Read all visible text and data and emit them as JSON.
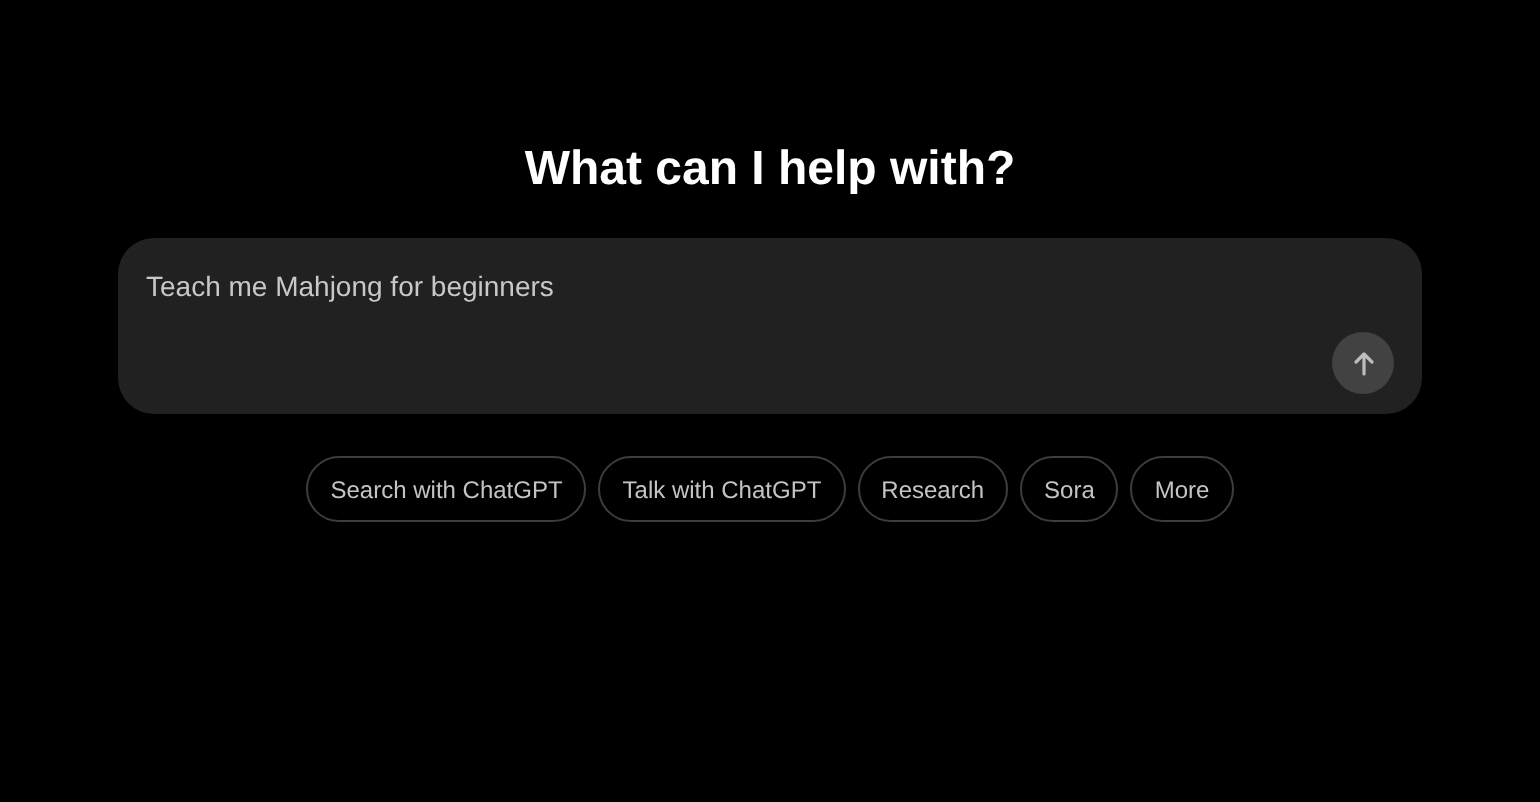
{
  "heading": "What can I help with?",
  "prompt": {
    "value": "Teach me Mahjong for beginners"
  },
  "chips": [
    {
      "label": "Search with ChatGPT"
    },
    {
      "label": "Talk with ChatGPT"
    },
    {
      "label": "Research"
    },
    {
      "label": "Sora"
    },
    {
      "label": "More"
    }
  ]
}
